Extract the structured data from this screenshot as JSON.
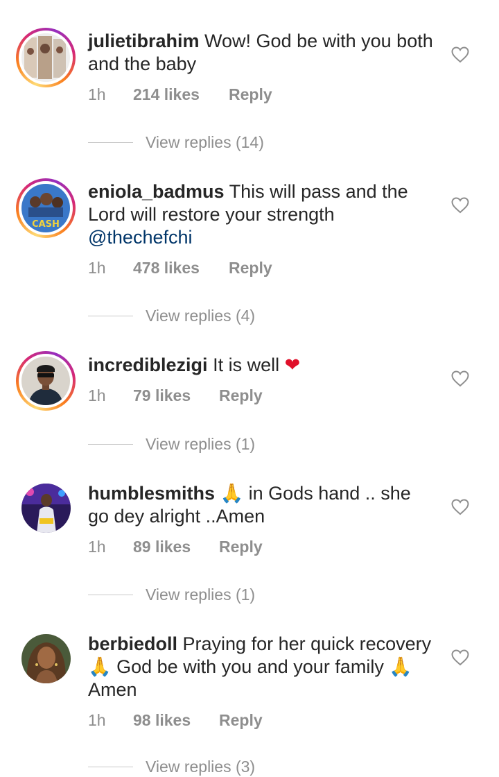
{
  "comments": [
    {
      "username": "julietibrahim",
      "text": "Wow! God be with you both and the baby",
      "time": "1h",
      "likes": "214 likes",
      "reply_label": "Reply",
      "view_replies": "View replies (14)",
      "avatar": "book-cover-avatar",
      "has_story_ring": true
    },
    {
      "username": "eniola_badmus",
      "text": "This will pass and the Lord will restore your strength",
      "mention": "@thechefchi",
      "time": "1h",
      "likes": "478 likes",
      "reply_label": "Reply",
      "view_replies": "View replies (4)",
      "avatar": "movie-poster-avatar",
      "avatar_text": "CASH",
      "has_story_ring": true
    },
    {
      "username": "incrediblezigi",
      "text": "It is well",
      "emoji": "❤",
      "time": "1h",
      "likes": "79 likes",
      "reply_label": "Reply",
      "view_replies": "View replies (1)",
      "avatar": "man-sunglasses-avatar",
      "has_story_ring": true
    },
    {
      "username": "humblesmiths",
      "text_part1": "🙏 in Gods hand .. she",
      "text_part2": "go dey alright ..Amen",
      "time": "1h",
      "likes": "89 likes",
      "reply_label": "Reply",
      "view_replies": "View replies (1)",
      "avatar": "performer-stage-avatar",
      "has_story_ring": false
    },
    {
      "username": "berbiedoll",
      "text_part1": "Praying for her quick recovery",
      "text_part2": "🙏 God be with you and your family ",
      "text_part3": "🙏",
      "text_part4": "Amen",
      "time": "1h",
      "likes": "98 likes",
      "reply_label": "Reply",
      "view_replies": "View replies (3)",
      "avatar": "woman-portrait-avatar",
      "has_story_ring": false
    }
  ],
  "colors": {
    "text": "#262626",
    "meta": "#8e8e8e",
    "mention": "#003569",
    "heart_emoji": "#e0102a"
  }
}
